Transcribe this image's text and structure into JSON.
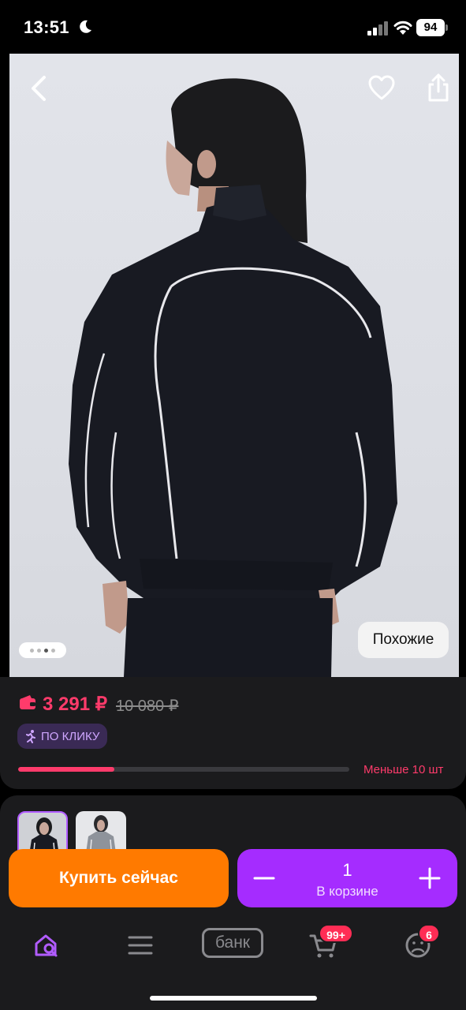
{
  "status_bar": {
    "time": "13:51",
    "battery": "94"
  },
  "product": {
    "similar_label": "Похожие",
    "image_count": 4,
    "active_image_index": 2
  },
  "pricing": {
    "price": "3 291 ₽",
    "old_price": "10 080 ₽",
    "badge": "ПО КЛИКУ",
    "stock_text": "Меньше 10 шт",
    "stock_fraction": 0.29
  },
  "actions": {
    "buy_now": "Купить сейчас",
    "quantity": "1",
    "in_cart_label": "В корзине"
  },
  "tabbar": {
    "bank_label": "банк",
    "cart_badge": "99+",
    "profile_badge": "6"
  },
  "colors": {
    "accent_pink": "#ff3b6b",
    "buy_orange": "#ff7a00",
    "cart_purple": "#a52cff",
    "badge_text": "#cfa6ff"
  }
}
